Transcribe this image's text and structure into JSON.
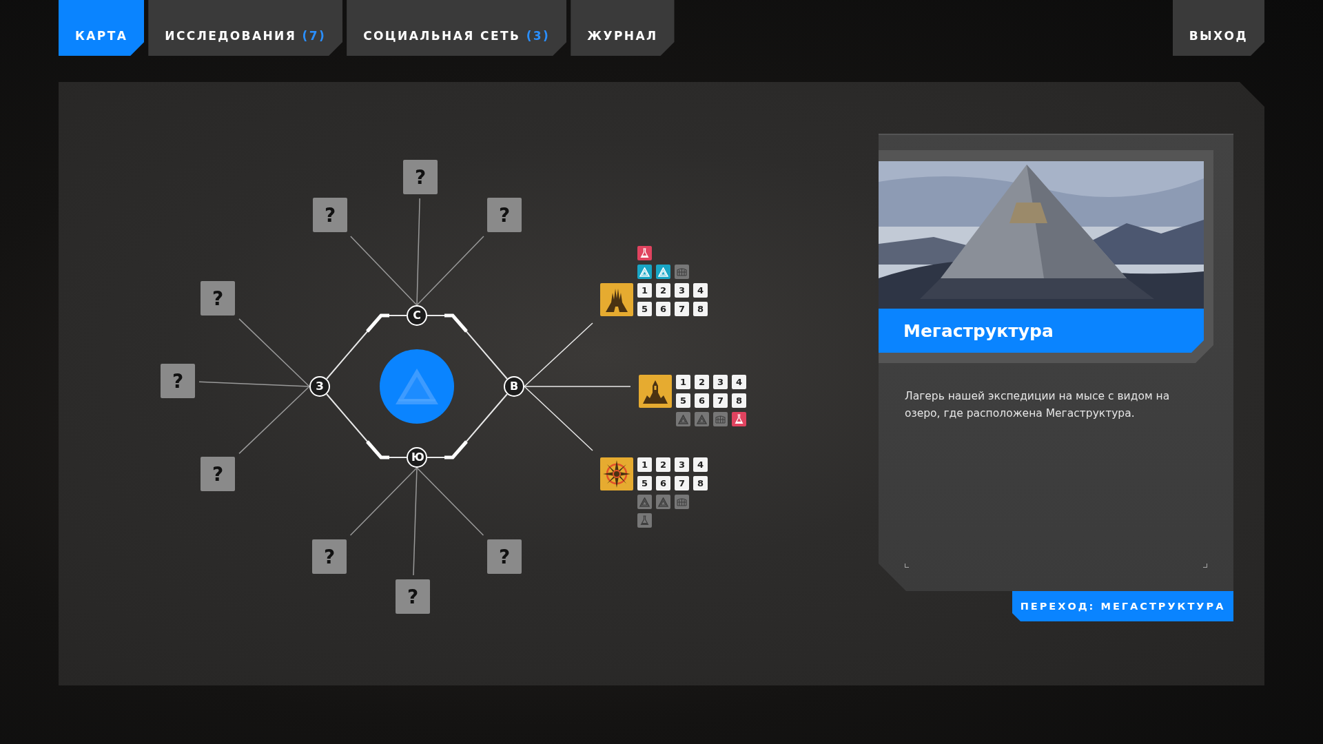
{
  "tabs": [
    {
      "label": "КАРТА",
      "selected": true
    },
    {
      "label": "ИССЛЕДОВАНИЯ",
      "count": "(7)",
      "selected": false
    },
    {
      "label": "СОЦИАЛЬНАЯ СЕТЬ",
      "count": "(3)",
      "selected": false
    },
    {
      "label": "ЖУРНАЛ",
      "selected": false
    }
  ],
  "exit_button": "ВЫХОД",
  "map": {
    "compass_points": [
      {
        "label": "С"
      },
      {
        "label": "З"
      },
      {
        "label": "В"
      },
      {
        "label": "Ю"
      }
    ],
    "unknown_nodes": [
      {
        "label": "?"
      },
      {
        "label": "?"
      },
      {
        "label": "?"
      },
      {
        "label": "?"
      },
      {
        "label": "?"
      },
      {
        "label": "?"
      },
      {
        "label": "?"
      },
      {
        "label": "?"
      },
      {
        "label": "?"
      }
    ],
    "locations": [
      {
        "kind": "towers",
        "tiles": [
          "1",
          "2",
          "3",
          "4",
          "5",
          "6",
          "7",
          "8"
        ],
        "rows_above": [
          [
            {
              "kind": "flask",
              "color": "#e0435f"
            }
          ],
          [
            {
              "kind": "triangle",
              "color": "#19a6c6"
            },
            {
              "kind": "triangle",
              "color": "#19a6c6"
            },
            {
              "kind": "gate",
              "color": "#777777"
            }
          ]
        ]
      },
      {
        "kind": "castle",
        "tiles": [
          "1",
          "2",
          "3",
          "4",
          "5",
          "6",
          "7",
          "8"
        ],
        "rows_below": [
          [
            {
              "kind": "triangle",
              "color": "#777777"
            },
            {
              "kind": "triangle",
              "color": "#777777"
            },
            {
              "kind": "gate",
              "color": "#777777"
            },
            {
              "kind": "flask",
              "color": "#e0435f"
            }
          ]
        ]
      },
      {
        "kind": "compass",
        "tiles": [
          "1",
          "2",
          "3",
          "4",
          "5",
          "6",
          "7",
          "8"
        ],
        "rows_below": [
          [
            {
              "kind": "triangle",
              "color": "#777777"
            },
            {
              "kind": "triangle",
              "color": "#777777"
            },
            {
              "kind": "gate",
              "color": "#777777"
            }
          ],
          [
            {
              "kind": "flask",
              "color": "#777777"
            }
          ]
        ]
      }
    ]
  },
  "info": {
    "title": "Мегаструктура",
    "description": "Лагерь нашей экспедиции на мысе с видом на озеро, где расположена Мегаструктура.",
    "action_button": "ПЕРЕХОД: МЕГАСТРУКТУРА"
  }
}
